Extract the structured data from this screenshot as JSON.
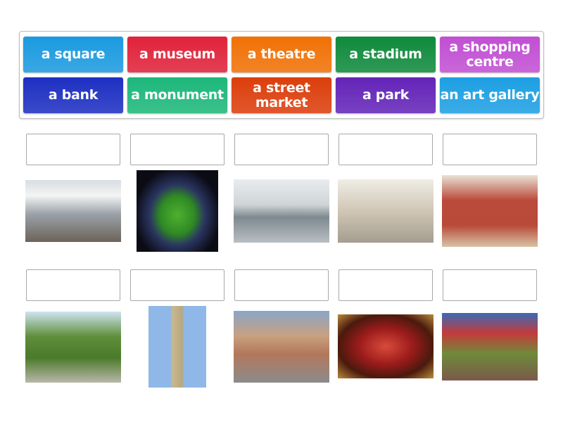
{
  "tiles": [
    {
      "label": "a square",
      "color": "#1b9ae0"
    },
    {
      "label": "a museum",
      "color": "#e0223a"
    },
    {
      "label": "a theatre",
      "color": "#f07106"
    },
    {
      "label": "a stadium",
      "color": "#0f8a3c"
    },
    {
      "label": "a shopping centre",
      "color": "#c14fd3"
    },
    {
      "label": "a bank",
      "color": "#1d2fc2"
    },
    {
      "label": "a monument",
      "color": "#1db77a"
    },
    {
      "label": "a street market",
      "color": "#dc3e0c"
    },
    {
      "label": "a park",
      "color": "#6324b8"
    },
    {
      "label": "an art gallery",
      "color": "#1d9fe3"
    }
  ],
  "pictures": [
    {
      "icon": "shopping-centre-photo"
    },
    {
      "icon": "stadium-photo"
    },
    {
      "icon": "bank-photo"
    },
    {
      "icon": "museum-photo"
    },
    {
      "icon": "art-gallery-photo"
    },
    {
      "icon": "park-photo"
    },
    {
      "icon": "monument-photo"
    },
    {
      "icon": "square-photo"
    },
    {
      "icon": "theatre-photo"
    },
    {
      "icon": "street-market-photo"
    }
  ]
}
